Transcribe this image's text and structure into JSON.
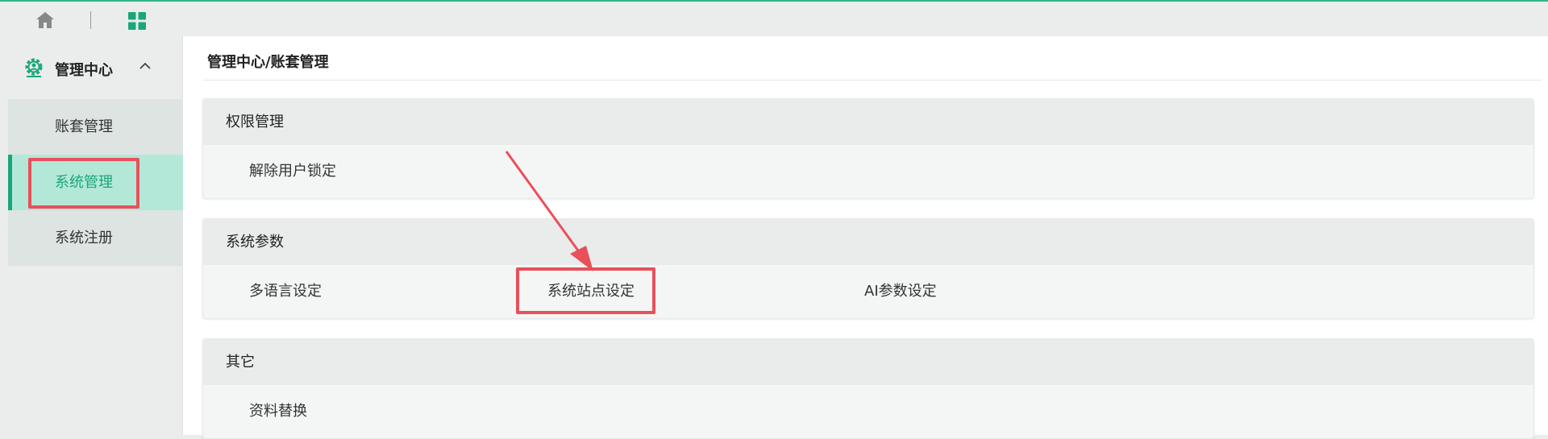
{
  "colors": {
    "accent": "#1aa67a",
    "annotation": "#e9505a"
  },
  "topbar": {
    "icons": [
      "home-icon",
      "grid-apps-icon"
    ]
  },
  "sidebar": {
    "group_title": "管理中心",
    "items": [
      {
        "label": "账套管理"
      },
      {
        "label": "系统管理"
      },
      {
        "label": "系统注册"
      }
    ]
  },
  "main": {
    "breadcrumb": "管理中心/账套管理",
    "panels": [
      {
        "title": "权限管理",
        "items": [
          "解除用户锁定"
        ]
      },
      {
        "title": "系统参数",
        "items": [
          "多语言设定",
          "系统站点设定",
          "AI参数设定"
        ]
      },
      {
        "title": "其它",
        "items": [
          "资料替换"
        ]
      }
    ]
  }
}
